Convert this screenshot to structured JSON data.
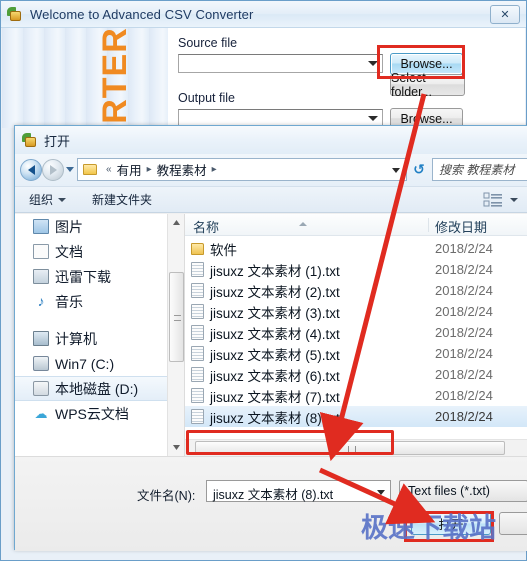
{
  "app": {
    "title": "Welcome to Advanced CSV Converter",
    "icon": "app-leaf-icon",
    "close_label": "✕",
    "banner_text": "RTER",
    "source_label": "Source file",
    "source_value": "",
    "output_label": "Output file",
    "output_value": "",
    "browse_label": "Browse...",
    "select_folder_label": "Select folder...",
    "browse2_label": "Browse..."
  },
  "dialog": {
    "title": "打开",
    "address": {
      "root_chevron": "«",
      "crumbs": [
        "有用",
        "教程素材"
      ],
      "separator": "▸",
      "refresh_icon": "refresh-icon"
    },
    "search_placeholder": "搜索 教程素材",
    "toolbar": {
      "organize_label": "组织",
      "new_folder_label": "新建文件夹",
      "views_icon": "views-list-icon"
    },
    "nav_pane": {
      "items": [
        {
          "label": "图片",
          "icon": "pictures-icon",
          "selected": false
        },
        {
          "label": "文档",
          "icon": "documents-icon",
          "selected": false
        },
        {
          "label": "迅雷下载",
          "icon": "downloads-icon",
          "selected": false
        },
        {
          "label": "音乐",
          "icon": "music-icon",
          "selected": false
        },
        {
          "label": "计算机",
          "icon": "computer-icon",
          "selected": false
        },
        {
          "label": "Win7 (C:)",
          "icon": "harddisk-icon",
          "selected": false
        },
        {
          "label": "本地磁盘 (D:)",
          "icon": "localdisk-icon",
          "selected": true
        },
        {
          "label": "WPS云文档",
          "icon": "cloud-icon",
          "selected": false
        }
      ]
    },
    "file_list": {
      "columns": [
        "名称",
        "修改日期"
      ],
      "rows": [
        {
          "name": "软件",
          "date": "2018/2/24",
          "icon": "folder-icon",
          "selected": false
        },
        {
          "name": "jisuxz 文本素材 (1).txt",
          "date": "2018/2/24",
          "icon": "text-file-icon",
          "selected": false
        },
        {
          "name": "jisuxz 文本素材 (2).txt",
          "date": "2018/2/24",
          "icon": "text-file-icon",
          "selected": false
        },
        {
          "name": "jisuxz 文本素材 (3).txt",
          "date": "2018/2/24",
          "icon": "text-file-icon",
          "selected": false
        },
        {
          "name": "jisuxz 文本素材 (4).txt",
          "date": "2018/2/24",
          "icon": "text-file-icon",
          "selected": false
        },
        {
          "name": "jisuxz 文本素材 (5).txt",
          "date": "2018/2/24",
          "icon": "text-file-icon",
          "selected": false
        },
        {
          "name": "jisuxz 文本素材 (6).txt",
          "date": "2018/2/24",
          "icon": "text-file-icon",
          "selected": false
        },
        {
          "name": "jisuxz 文本素材 (7).txt",
          "date": "2018/2/24",
          "icon": "text-file-icon",
          "selected": false
        },
        {
          "name": "jisuxz 文本素材 (8).txt",
          "date": "2018/2/24",
          "icon": "text-file-icon",
          "selected": true
        }
      ]
    },
    "bottom": {
      "filename_label": "文件名(N):",
      "filename_value": "jisuxz 文本素材 (8).txt",
      "filter_value": "Text files (*.txt)",
      "open_label": "打开",
      "cancel_label": ""
    }
  },
  "watermark": "极速下载站",
  "colors": {
    "accent_blue": "#4a9bc7",
    "highlight_red": "#e02b20",
    "brand_orange": "#f08a21",
    "watermark_blue": "#5b74c8",
    "selection_blue": "#d3e7f8"
  }
}
